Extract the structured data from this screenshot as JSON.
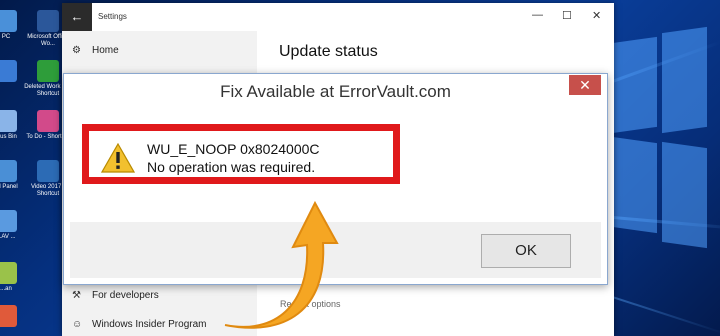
{
  "desktop": {
    "icons": [
      {
        "label": "PC",
        "icon": "computer-icon",
        "color": "#4a90d9"
      },
      {
        "label": "Microsoft Office Wo...",
        "icon": "word-icon",
        "color": "#2b579a"
      },
      {
        "label": "",
        "icon": "folder-icon",
        "color": "#3a7bd5"
      },
      {
        "label": "Deleted Work ID - Shortcut",
        "icon": "shield-check-icon",
        "color": "#2e9d3a"
      },
      {
        "label": "...us Bin",
        "icon": "recycle-bin-icon",
        "color": "#8ab4e8"
      },
      {
        "label": "To Do - Shortcut",
        "icon": "colorful-app-icon",
        "color": "#d24a8a"
      },
      {
        "label": "...l Panel",
        "icon": "control-panel-icon",
        "color": "#4a8fd6"
      },
      {
        "label": "Video 2017 - Shortcut",
        "icon": "video-icon",
        "color": "#2c6bb5"
      },
      {
        "label": "...AV ...",
        "icon": "settings-icon",
        "color": "#5a9ae0"
      },
      {
        "label": "...an",
        "icon": "app-icon",
        "color": "#9ac24a"
      },
      {
        "label": "",
        "icon": "app-icon",
        "color": "#e05a3a"
      }
    ]
  },
  "settings_window": {
    "title": "Settings",
    "back_glyph": "←",
    "minimize_glyph": "—",
    "maximize_glyph": "☐",
    "close_glyph": "✕",
    "home_label": "Home",
    "heading": "Update status",
    "nav_bottom": [
      {
        "label": "For developers",
        "icon": "developer-icon"
      },
      {
        "label": "Windows Insider Program",
        "icon": "insider-icon"
      }
    ],
    "right_bottom": [
      "Restart options"
    ]
  },
  "dialog": {
    "title": "Fix Available at ErrorVault.com",
    "close_glyph": "✕",
    "error_code": "WU_E_NOOP 0x8024000C",
    "error_message": "No operation was required.",
    "ok_label": "OK",
    "highlight_color": "#e0191b",
    "arrow_color": "#f5a623"
  }
}
